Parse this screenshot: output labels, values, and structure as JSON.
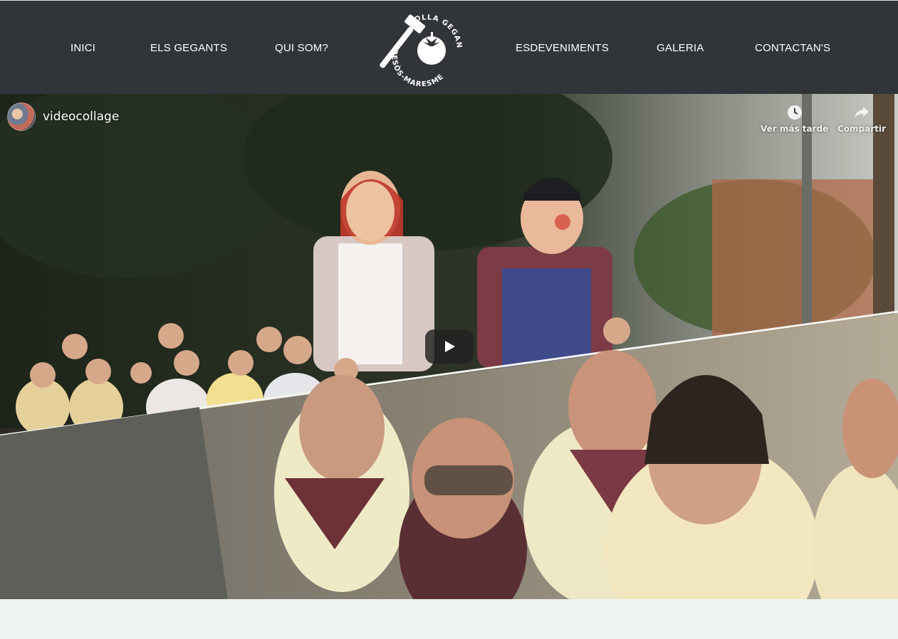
{
  "nav": {
    "left": [
      {
        "label": "INICI"
      },
      {
        "label": "ELS GEGANTS"
      },
      {
        "label": "QUI SOM?"
      }
    ],
    "right": [
      {
        "label": "ESDEVENIMENTS"
      },
      {
        "label": "GALERIA"
      },
      {
        "label": "CONTACTAN'S"
      }
    ],
    "logo": {
      "top_text": "COLLA GEGANTERA",
      "bottom_text": "BESÒS-MARESME"
    }
  },
  "video": {
    "channel_name": "videocollage",
    "watch_later_label": "Ver más tarde",
    "share_label": "Compartir",
    "play_icon": "play-icon"
  },
  "colors": {
    "navbar_bg": "#313539",
    "nav_text": "#ffffff",
    "page_bg": "#eef2f2",
    "play_bg": "#212121"
  }
}
